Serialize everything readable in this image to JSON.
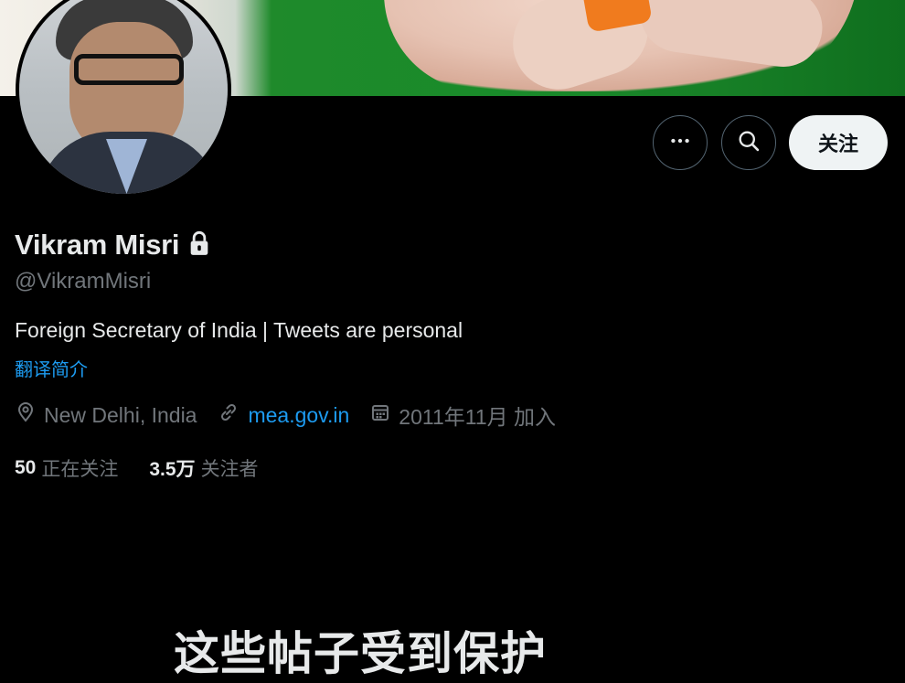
{
  "profile": {
    "name": "Vikram Misri",
    "handle": "@VikramMisri",
    "bio": "Foreign Secretary of India | Tweets are personal",
    "translate_bio": "翻译简介",
    "location": "New Delhi, India",
    "website": "mea.gov.in",
    "joined": "2011年11月 加入"
  },
  "actions": {
    "follow_label": "关注"
  },
  "stats": {
    "following_count": "50",
    "following_label": "正在关注",
    "followers_count": "3.5万",
    "followers_label": "关注者"
  },
  "protected_notice": {
    "title": "这些帖子受到保护"
  },
  "icons": {
    "more": "more-icon",
    "search": "search-icon",
    "lock": "lock-icon",
    "location": "location-icon",
    "link": "link-icon",
    "calendar": "calendar-icon"
  },
  "colors": {
    "background": "#000000",
    "text_primary": "#e7e9ea",
    "text_secondary": "#71767b",
    "accent_blue": "#1d9bf0",
    "button_light": "#eff3f4"
  }
}
